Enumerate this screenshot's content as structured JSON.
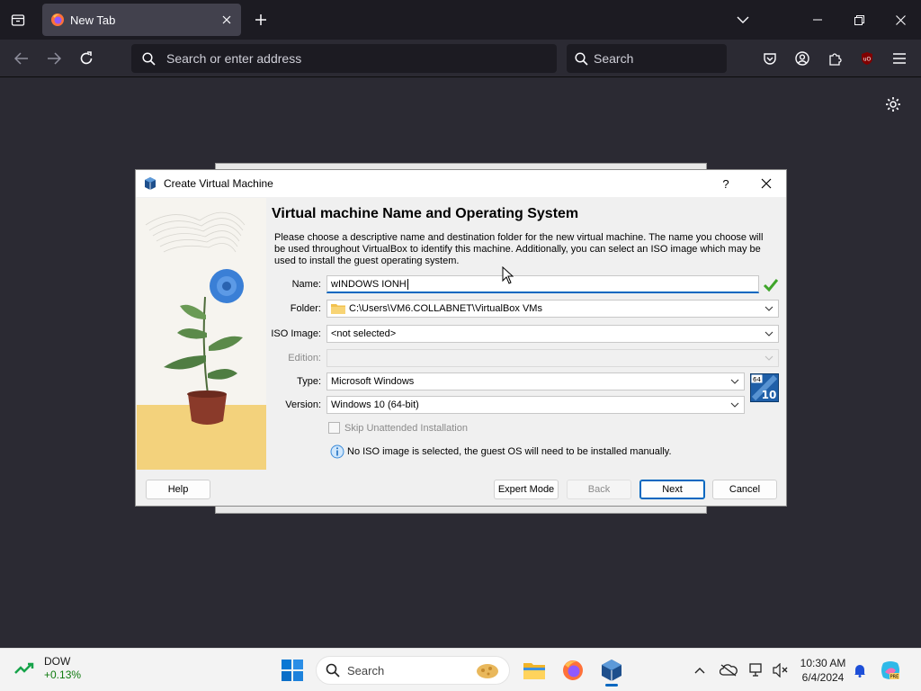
{
  "browser": {
    "tab_title": "New Tab",
    "url_placeholder": "Search or enter address",
    "search_placeholder": "Search"
  },
  "dialog": {
    "title": "Create Virtual Machine",
    "help_glyph": "?",
    "heading": "Virtual machine Name and Operating System",
    "description": "Please choose a descriptive name and destination folder for the new virtual machine. The name you choose will be used throughout VirtualBox to identify this machine. Additionally, you can select an ISO image which may be used to install the guest operating system.",
    "labels": {
      "name": "Name:",
      "folder": "Folder:",
      "iso": "ISO Image:",
      "edition": "Edition:",
      "type": "Type:",
      "version": "Version:"
    },
    "values": {
      "name": "wINDOWS IONH",
      "folder": "C:\\Users\\VM6.COLLABNET\\VirtualBox VMs",
      "iso": "<not selected>",
      "edition": "",
      "type": "Microsoft Windows",
      "version": "Windows 10 (64-bit)"
    },
    "os_badge": {
      "bits": "64",
      "ver": "10"
    },
    "skip_unattended": "Skip Unattended Installation",
    "info_text": "No ISO image is selected, the guest OS will need to be installed manually.",
    "buttons": {
      "help": "Help",
      "expert": "Expert Mode",
      "back": "Back",
      "next": "Next",
      "cancel": "Cancel"
    }
  },
  "taskbar": {
    "widget_name": "DOW",
    "widget_change": "+0.13%",
    "search_placeholder": "Search",
    "time": "10:30 AM",
    "date": "6/4/2024"
  },
  "colors": {
    "accent": "#0067c0",
    "browser_bg": "#2b2a33",
    "tabbar_bg": "#1c1b22",
    "stock_green": "#0f7b0f"
  }
}
